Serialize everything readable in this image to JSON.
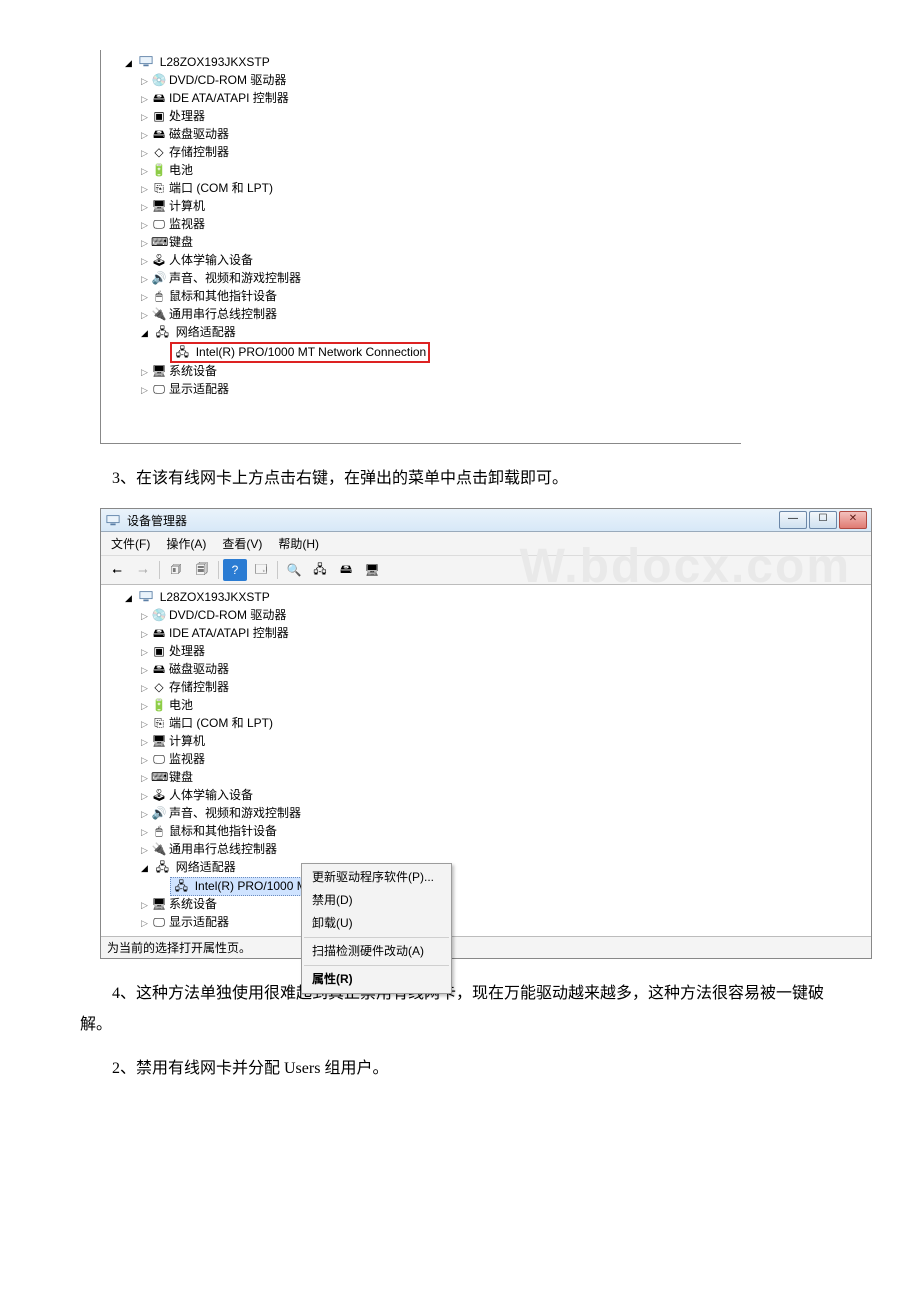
{
  "article": {
    "step3": "3、在该有线网卡上方点击右键，在弹出的菜单中点击卸载即可。",
    "step4": "4、这种方法单独使用很难起到真正禁用有线网卡，现在万能驱动越来越多，这种方法很容易被一键破解。",
    "step2b": "2、禁用有线网卡并分配 Users 组用户。"
  },
  "watermark": "W.bdocx.com",
  "dm1": {
    "root": "L28ZOX193JKXSTP",
    "nodes": [
      "DVD/CD-ROM 驱动器",
      "IDE ATA/ATAPI 控制器",
      "处理器",
      "磁盘驱动器",
      "存储控制器",
      "电池",
      "端口 (COM 和 LPT)",
      "计算机",
      "监视器",
      "键盘",
      "人体学输入设备",
      "声音、视频和游戏控制器",
      "鼠标和其他指针设备",
      "通用串行总线控制器"
    ],
    "net": "网络适配器",
    "nic": "Intel(R) PRO/1000 MT Network Connection",
    "sys": "系统设备",
    "disp": "显示适配器"
  },
  "dm2": {
    "title": "设备管理器",
    "menu": {
      "file": "文件(F)",
      "action": "操作(A)",
      "view": "查看(V)",
      "help": "帮助(H)"
    },
    "root": "L28ZOX193JKXSTP",
    "nodes": [
      "DVD/CD-ROM 驱动器",
      "IDE ATA/ATAPI 控制器",
      "处理器",
      "磁盘驱动器",
      "存储控制器",
      "电池",
      "端口 (COM 和 LPT)",
      "计算机",
      "监视器",
      "键盘",
      "人体学输入设备",
      "声音、视频和游戏控制器",
      "鼠标和其他指针设备",
      "通用串行总线控制器"
    ],
    "net": "网络适配器",
    "nic": "Intel(R) PRO/1000 MT Network Connection",
    "sys": "系统设备",
    "disp": "显示适配器",
    "ctx": {
      "update": "更新驱动程序软件(P)...",
      "disable": "禁用(D)",
      "uninstall": "卸载(U)",
      "scan": "扫描检测硬件改动(A)",
      "props": "属性(R)"
    },
    "status": "为当前的选择打开属性页。"
  }
}
